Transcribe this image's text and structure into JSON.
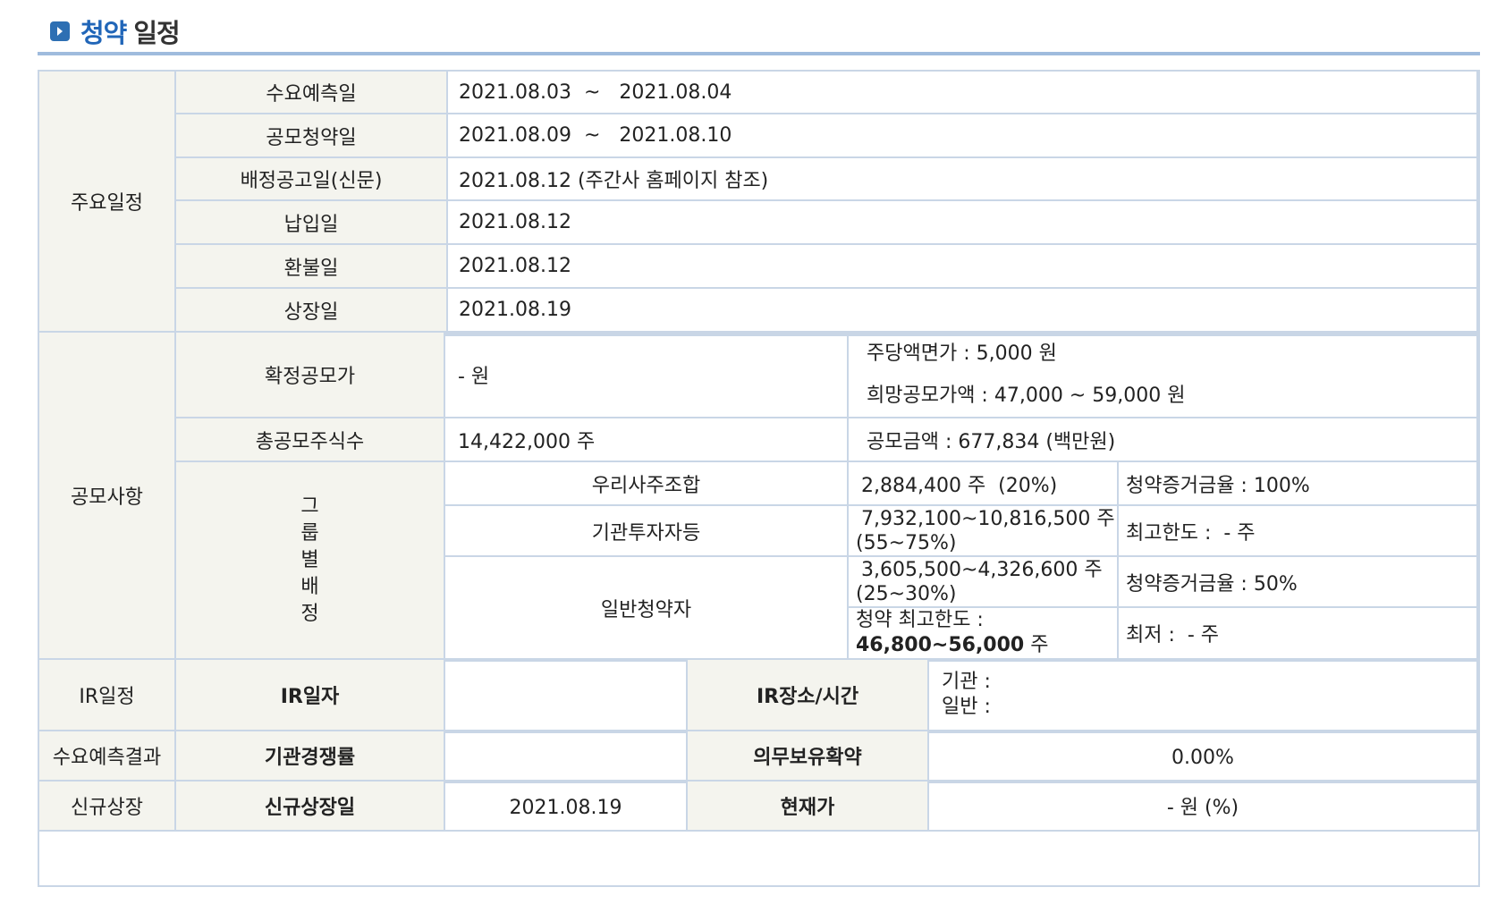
{
  "header": {
    "title_accent": "청약",
    "title_rest": "일정"
  },
  "schedule": {
    "label": "주요일정",
    "rows": [
      {
        "label": "수요예측일",
        "value": "2021.08.03  ~   2021.08.04"
      },
      {
        "label": "공모청약일",
        "value": "2021.08.09  ~   2021.08.10"
      },
      {
        "label": "배정공고일(신문)",
        "value": "2021.08.12 (주간사 홈페이지 참조)"
      },
      {
        "label": "납입일",
        "value": "2021.08.12"
      },
      {
        "label": "환불일",
        "value": "2021.08.12"
      },
      {
        "label": "상장일",
        "value": "2021.08.19"
      }
    ]
  },
  "offering": {
    "label": "공모사항",
    "confirmed_price_label": "확정공모가",
    "confirmed_price_value": "- 원",
    "par_value": "주당액면가 :  5,000 원",
    "desired_price": "희망공모가액 :  47,000 ~ 59,000 원",
    "total_shares_label": "총공모주식수",
    "total_shares_value": "14,422,000 주",
    "offering_amount": "공모금액 : 677,834 (백만원)",
    "group_label": [
      "그",
      "룹",
      "별",
      "배",
      "정"
    ],
    "groups": {
      "employee": {
        "name": "우리사주조합",
        "shares": "2,884,400 주  (20%)",
        "note": "청약증거금율 : 100%"
      },
      "institution": {
        "name": "기관투자자등",
        "shares_line1": "7,932,100~10,816,500 주",
        "shares_line2": "(55~75%)",
        "note": "최고한도 :  - 주"
      },
      "retail": {
        "name": "일반청약자",
        "shares_line1": "3,605,500~4,326,600 주",
        "shares_line2": "(25~30%)",
        "note": "청약증거금율 : 50%",
        "limit_label": "청약 최고한도 :",
        "limit_value": "46,800~56,000",
        "limit_unit": " 주",
        "min_note": "최저 :  - 주"
      }
    }
  },
  "ir": {
    "label": "IR일정",
    "date_label": "IR일자",
    "date_value": "",
    "place_label": "IR장소/시간",
    "institution": "기관 :",
    "general": "일반 :"
  },
  "demand": {
    "label": "수요예측결과",
    "competition_label": "기관경쟁률",
    "competition_value": "",
    "lockup_label": "의무보유확약",
    "lockup_value": "0.00%"
  },
  "listing": {
    "label": "신규상장",
    "date_label": "신규상장일",
    "date_value": "2021.08.19",
    "price_label": "현재가",
    "price_value": "- 원 (%)"
  }
}
